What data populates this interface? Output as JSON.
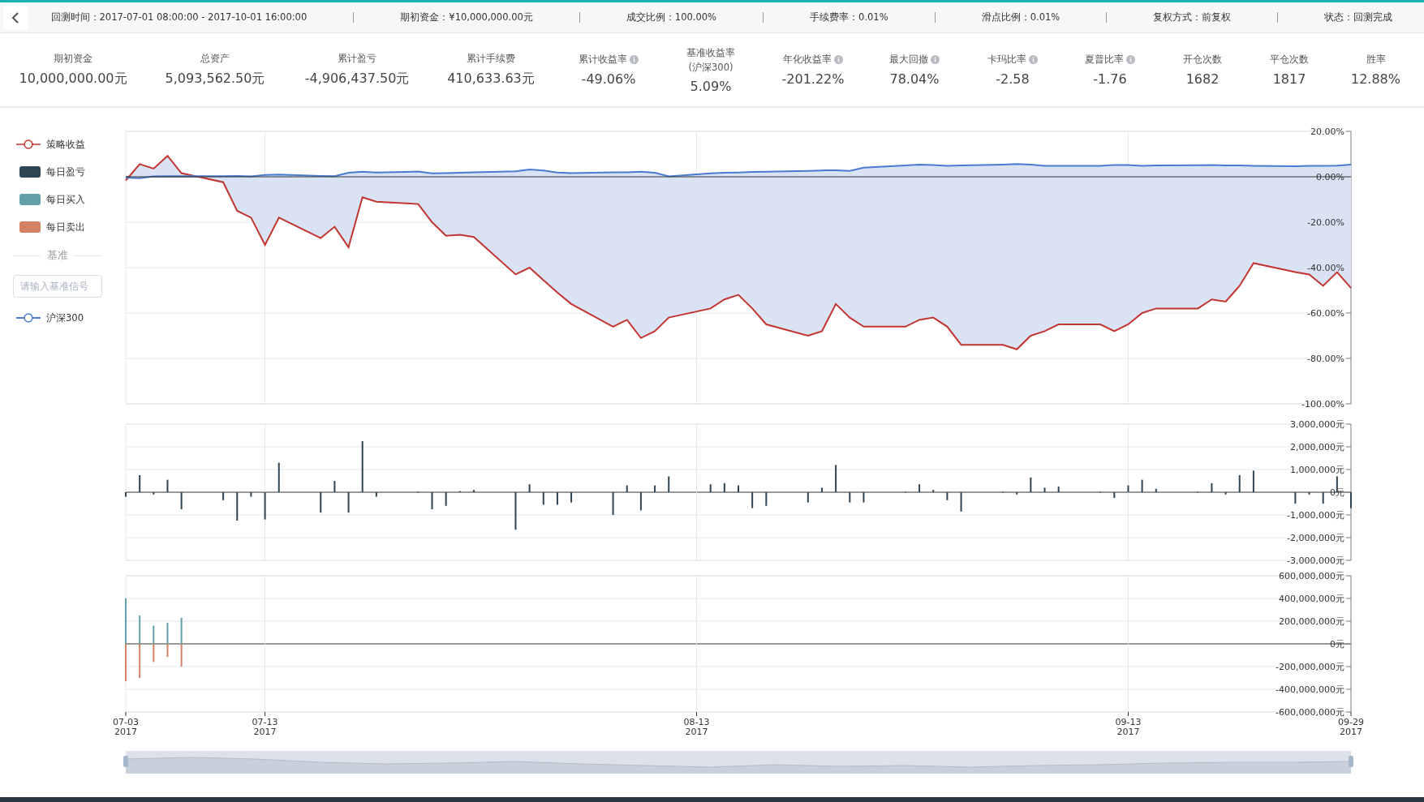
{
  "info_bar": {
    "items": [
      {
        "label": "回测时间：",
        "value": "2017-07-01 08:00:00 - 2017-10-01 16:00:00"
      },
      {
        "label": "期初资金：",
        "value": "¥10,000,000.00元"
      },
      {
        "label": "成交比例：",
        "value": "100.00%"
      },
      {
        "label": "手续费率：",
        "value": "0.01%"
      },
      {
        "label": "滑点比例：",
        "value": "0.01%"
      },
      {
        "label": "复权方式：",
        "value": "前复权"
      },
      {
        "label": "状态：",
        "value": "回测完成"
      }
    ]
  },
  "stats": [
    {
      "label": "期初资金",
      "value": "10,000,000.00元",
      "info": false
    },
    {
      "label": "总资产",
      "value": "5,093,562.50元",
      "info": false
    },
    {
      "label": "累计盈亏",
      "value": "-4,906,437.50元",
      "info": false
    },
    {
      "label": "累计手续费",
      "value": "410,633.63元",
      "info": false
    },
    {
      "label": "累计收益率",
      "value": "-49.06%",
      "info": true
    },
    {
      "label": "基准收益率",
      "sublabel": "(沪深300)",
      "value": "5.09%",
      "info": false
    },
    {
      "label": "年化收益率",
      "value": "-201.22%",
      "info": true
    },
    {
      "label": "最大回撤",
      "value": "78.04%",
      "info": true
    },
    {
      "label": "卡玛比率",
      "value": "-2.58",
      "info": true
    },
    {
      "label": "夏普比率",
      "value": "-1.76",
      "info": true
    },
    {
      "label": "开仓次数",
      "value": "1682",
      "info": false
    },
    {
      "label": "平仓次数",
      "value": "1817",
      "info": false
    },
    {
      "label": "胜率",
      "value": "12.88%",
      "info": false
    }
  ],
  "legend": [
    {
      "kind": "line"
    },
    {
      "kind": "block"
    },
    {
      "kind": "block"
    },
    {
      "kind": "block"
    }
  ],
  "benchmark": {
    "heading": "基准",
    "placeholder": "请输入基准信号",
    "items": [
      {
        "kind": "line"
      }
    ]
  },
  "charts": [
    {
      "chart_data": {
        "type": "line",
        "grid": true,
        "categories": [
          null,
          null,
          null,
          null,
          null,
          null,
          null,
          null,
          null,
          null,
          null,
          null,
          null,
          null,
          null,
          null,
          null,
          null,
          null,
          null,
          null,
          null,
          null,
          null,
          null,
          null,
          null,
          null,
          null,
          null,
          null,
          null,
          null,
          null,
          null,
          null,
          null,
          null,
          null,
          null,
          null,
          null,
          null,
          null,
          null,
          null,
          null,
          null,
          null,
          null,
          null,
          null,
          null,
          null,
          null,
          null,
          null,
          null,
          null,
          null,
          null,
          null,
          null,
          null,
          null,
          null,
          null,
          null,
          null,
          null,
          null,
          null,
          null,
          null,
          null,
          null,
          null,
          null,
          null,
          null,
          null,
          null,
          null,
          null,
          null,
          null,
          null,
          null,
          null
        ],
        "series": [
          {
            "name": "策略收益",
            "color": "#c23531",
            "values": [
              -1.6,
              5.6,
              3.6,
              9.2,
              1.6,
              null,
              null,
              -2.4,
              -15,
              -18,
              -30,
              -18,
              null,
              null,
              -27,
              -22,
              -31,
              -9,
              -11,
              null,
              null,
              -12,
              -20,
              -26,
              -25.5,
              -26.5,
              null,
              null,
              -43,
              -40,
              -45.5,
              -51,
              -56,
              null,
              null,
              -66,
              -63,
              -71,
              -68,
              -62,
              null,
              null,
              -58,
              -54,
              -52,
              -58,
              -65,
              null,
              null,
              -70,
              -68,
              -56,
              -62,
              -66,
              null,
              null,
              -66,
              -63,
              -62,
              -66,
              -74,
              null,
              null,
              -74,
              -76,
              -70,
              -68,
              -65,
              null,
              null,
              -65,
              -68,
              -65,
              -60,
              -58,
              null,
              null,
              -58,
              -54,
              -55,
              -48,
              -38,
              null,
              null,
              -42,
              -43,
              -48,
              -42,
              -49
            ]
          },
          {
            "name": "沪深300",
            "color": "#4a7bd0",
            "values": [
              -0.4,
              -0.6,
              0.2,
              0.3,
              0.3,
              null,
              null,
              0.3,
              0.4,
              0.2,
              0.8,
              1.0,
              null,
              null,
              0.4,
              0.3,
              1.8,
              2.2,
              1.9,
              null,
              null,
              2.3,
              1.5,
              1.6,
              1.8,
              2.0,
              null,
              null,
              2.4,
              3.2,
              2.8,
              1.9,
              1.6,
              null,
              null,
              2.0,
              2.0,
              2.2,
              1.8,
              0.2,
              null,
              null,
              1.5,
              1.8,
              1.9,
              2.1,
              2.2,
              null,
              null,
              2.6,
              2.8,
              2.9,
              2.6,
              4.0,
              null,
              null,
              5.0,
              5.4,
              5.2,
              4.8,
              5.0,
              null,
              null,
              5.4,
              5.6,
              5.4,
              4.8,
              4.8,
              null,
              null,
              4.8,
              5.2,
              5.2,
              4.8,
              5.0,
              null,
              null,
              5.1,
              5.2,
              5.0,
              5.0,
              4.8,
              null,
              null,
              4.6,
              4.8,
              4.8,
              4.9,
              5.4
            ]
          }
        ],
        "ylim": [
          -100,
          20
        ],
        "yticks": [
          {
            "value": 20,
            "label": "20.00%"
          },
          {
            "value": 0,
            "label": "0.00%"
          },
          {
            "value": -20,
            "label": "-20.00%"
          },
          {
            "value": -40,
            "label": "-40.00%"
          },
          {
            "value": -60,
            "label": "-60.00%"
          },
          {
            "value": -80,
            "label": "-80.00%"
          },
          {
            "value": -100,
            "label": "-100.00%"
          }
        ]
      }
    },
    {
      "chart_data": {
        "type": "bar",
        "grid": true,
        "categories": [
          null,
          null,
          null,
          null,
          null,
          null,
          null,
          null,
          null,
          null,
          null,
          null,
          null,
          null,
          null,
          null,
          null,
          null,
          null,
          null,
          null,
          null,
          null,
          null,
          null,
          null,
          null,
          null,
          null,
          null,
          null,
          null,
          null,
          null,
          null,
          null,
          null,
          null,
          null,
          null,
          null,
          null,
          null,
          null,
          null,
          null,
          null,
          null,
          null,
          null,
          null,
          null,
          null,
          null,
          null,
          null,
          null,
          null,
          null,
          null,
          null,
          null,
          null,
          null,
          null,
          null,
          null,
          null,
          null,
          null,
          null,
          null,
          null,
          null,
          null,
          null,
          null,
          null,
          null,
          null,
          null,
          null,
          null,
          null,
          null,
          null,
          null,
          null,
          null
        ],
        "series": [
          {
            "name": "每日盈亏",
            "color": "#2f4554",
            "values": [
              -200000,
              750000,
              -100000,
              550000,
              -750000,
              null,
              null,
              -350000,
              -1250000,
              -200000,
              -1200000,
              1300000,
              null,
              null,
              -900000,
              500000,
              -900000,
              2250000,
              -200000,
              null,
              null,
              20000,
              -750000,
              -600000,
              50000,
              100000,
              null,
              null,
              -1650000,
              350000,
              -550000,
              -550000,
              -450000,
              null,
              null,
              -1000000,
              300000,
              -800000,
              300000,
              700000,
              null,
              null,
              350000,
              400000,
              300000,
              -700000,
              -600000,
              null,
              null,
              -450000,
              200000,
              1200000,
              -450000,
              -450000,
              null,
              null,
              20000,
              350000,
              100000,
              -350000,
              -850000,
              null,
              null,
              20000,
              -100000,
              650000,
              200000,
              250000,
              null,
              null,
              20000,
              -250000,
              300000,
              550000,
              150000,
              null,
              null,
              20000,
              400000,
              -100000,
              750000,
              950000,
              null,
              null,
              -500000,
              -100000,
              -500000,
              700000,
              -700000
            ]
          }
        ],
        "ylim": [
          -3000000,
          3000000
        ],
        "yticks": [
          {
            "value": 3000000,
            "label": "3,000,000元"
          },
          {
            "value": 2000000,
            "label": "2,000,000元"
          },
          {
            "value": 1000000,
            "label": "1,000,000元"
          },
          {
            "value": 0,
            "label": "0元"
          },
          {
            "value": -1000000,
            "label": "-1,000,000元"
          },
          {
            "value": -2000000,
            "label": "-2,000,000元"
          },
          {
            "value": -3000000,
            "label": "-3,000,000元"
          }
        ]
      }
    },
    {
      "chart_data": {
        "type": "bar",
        "grid": true,
        "categories": [
          "07-03\n2017",
          null,
          null,
          null,
          null,
          null,
          null,
          null,
          null,
          null,
          "07-13\n2017",
          null,
          null,
          null,
          null,
          null,
          null,
          null,
          null,
          null,
          null,
          null,
          null,
          null,
          null,
          null,
          null,
          null,
          null,
          null,
          null,
          null,
          null,
          null,
          null,
          null,
          null,
          null,
          null,
          null,
          null,
          "08-13\n2017",
          null,
          null,
          null,
          null,
          null,
          null,
          null,
          null,
          null,
          null,
          null,
          null,
          null,
          null,
          null,
          null,
          null,
          null,
          null,
          null,
          null,
          null,
          null,
          null,
          null,
          null,
          null,
          null,
          null,
          null,
          "09-13\n2017",
          null,
          null,
          null,
          null,
          null,
          null,
          null,
          null,
          null,
          null,
          null,
          null,
          null,
          null,
          null,
          "09-29\n2017"
        ],
        "series": [
          {
            "name": "每日买入",
            "color": "#61a0a8",
            "values": [
              400000000,
              250000000,
              160000000,
              185000000,
              230000000,
              null,
              null,
              null,
              null,
              null,
              null,
              null,
              null,
              null,
              null,
              null,
              null,
              null,
              null,
              null,
              null,
              null,
              null,
              null,
              null,
              null,
              null,
              null,
              null,
              null,
              null,
              null,
              null,
              null,
              null,
              null,
              null,
              null,
              null,
              null,
              null,
              null,
              null,
              null,
              null,
              null,
              null,
              null,
              null,
              null,
              null,
              null,
              null,
              null,
              null,
              null,
              null,
              null,
              null,
              null,
              null,
              null,
              null,
              null,
              null,
              null,
              null,
              null,
              null,
              null,
              null,
              null,
              null,
              null,
              null,
              null,
              null,
              null,
              null,
              null,
              null,
              null,
              null,
              null,
              null,
              null,
              null,
              null,
              null
            ]
          },
          {
            "name": "每日卖出",
            "color": "#d48265",
            "values": [
              -330000000,
              -300000000,
              -160000000,
              -115000000,
              -200000000,
              null,
              null,
              null,
              null,
              null,
              null,
              null,
              null,
              null,
              null,
              null,
              null,
              null,
              null,
              null,
              null,
              null,
              null,
              null,
              null,
              null,
              null,
              null,
              null,
              null,
              null,
              null,
              null,
              null,
              null,
              null,
              null,
              null,
              null,
              null,
              null,
              null,
              null,
              null,
              null,
              null,
              null,
              null,
              null,
              null,
              null,
              null,
              null,
              null,
              null,
              null,
              null,
              null,
              null,
              null,
              null,
              null,
              null,
              null,
              null,
              null,
              null,
              null,
              null,
              null,
              null,
              null,
              null,
              null,
              null,
              null,
              null,
              null,
              null,
              null,
              null,
              null,
              null,
              null,
              null,
              null,
              null,
              null,
              null
            ]
          }
        ],
        "ylim": [
          -600000000,
          600000000
        ],
        "yticks": [
          {
            "value": 600000000,
            "label": "600,000,000元"
          },
          {
            "value": 400000000,
            "label": "400,000,000元"
          },
          {
            "value": 200000000,
            "label": "200,000,000元"
          },
          {
            "value": 0,
            "label": "0元"
          },
          {
            "value": -200000000,
            "label": "-200,000,000元"
          },
          {
            "value": -400000000,
            "label": "-400,000,000元"
          },
          {
            "value": -600000000,
            "label": "-600,000,000元"
          }
        ]
      }
    }
  ],
  "zoom_slider": {
    "level": 1
  }
}
